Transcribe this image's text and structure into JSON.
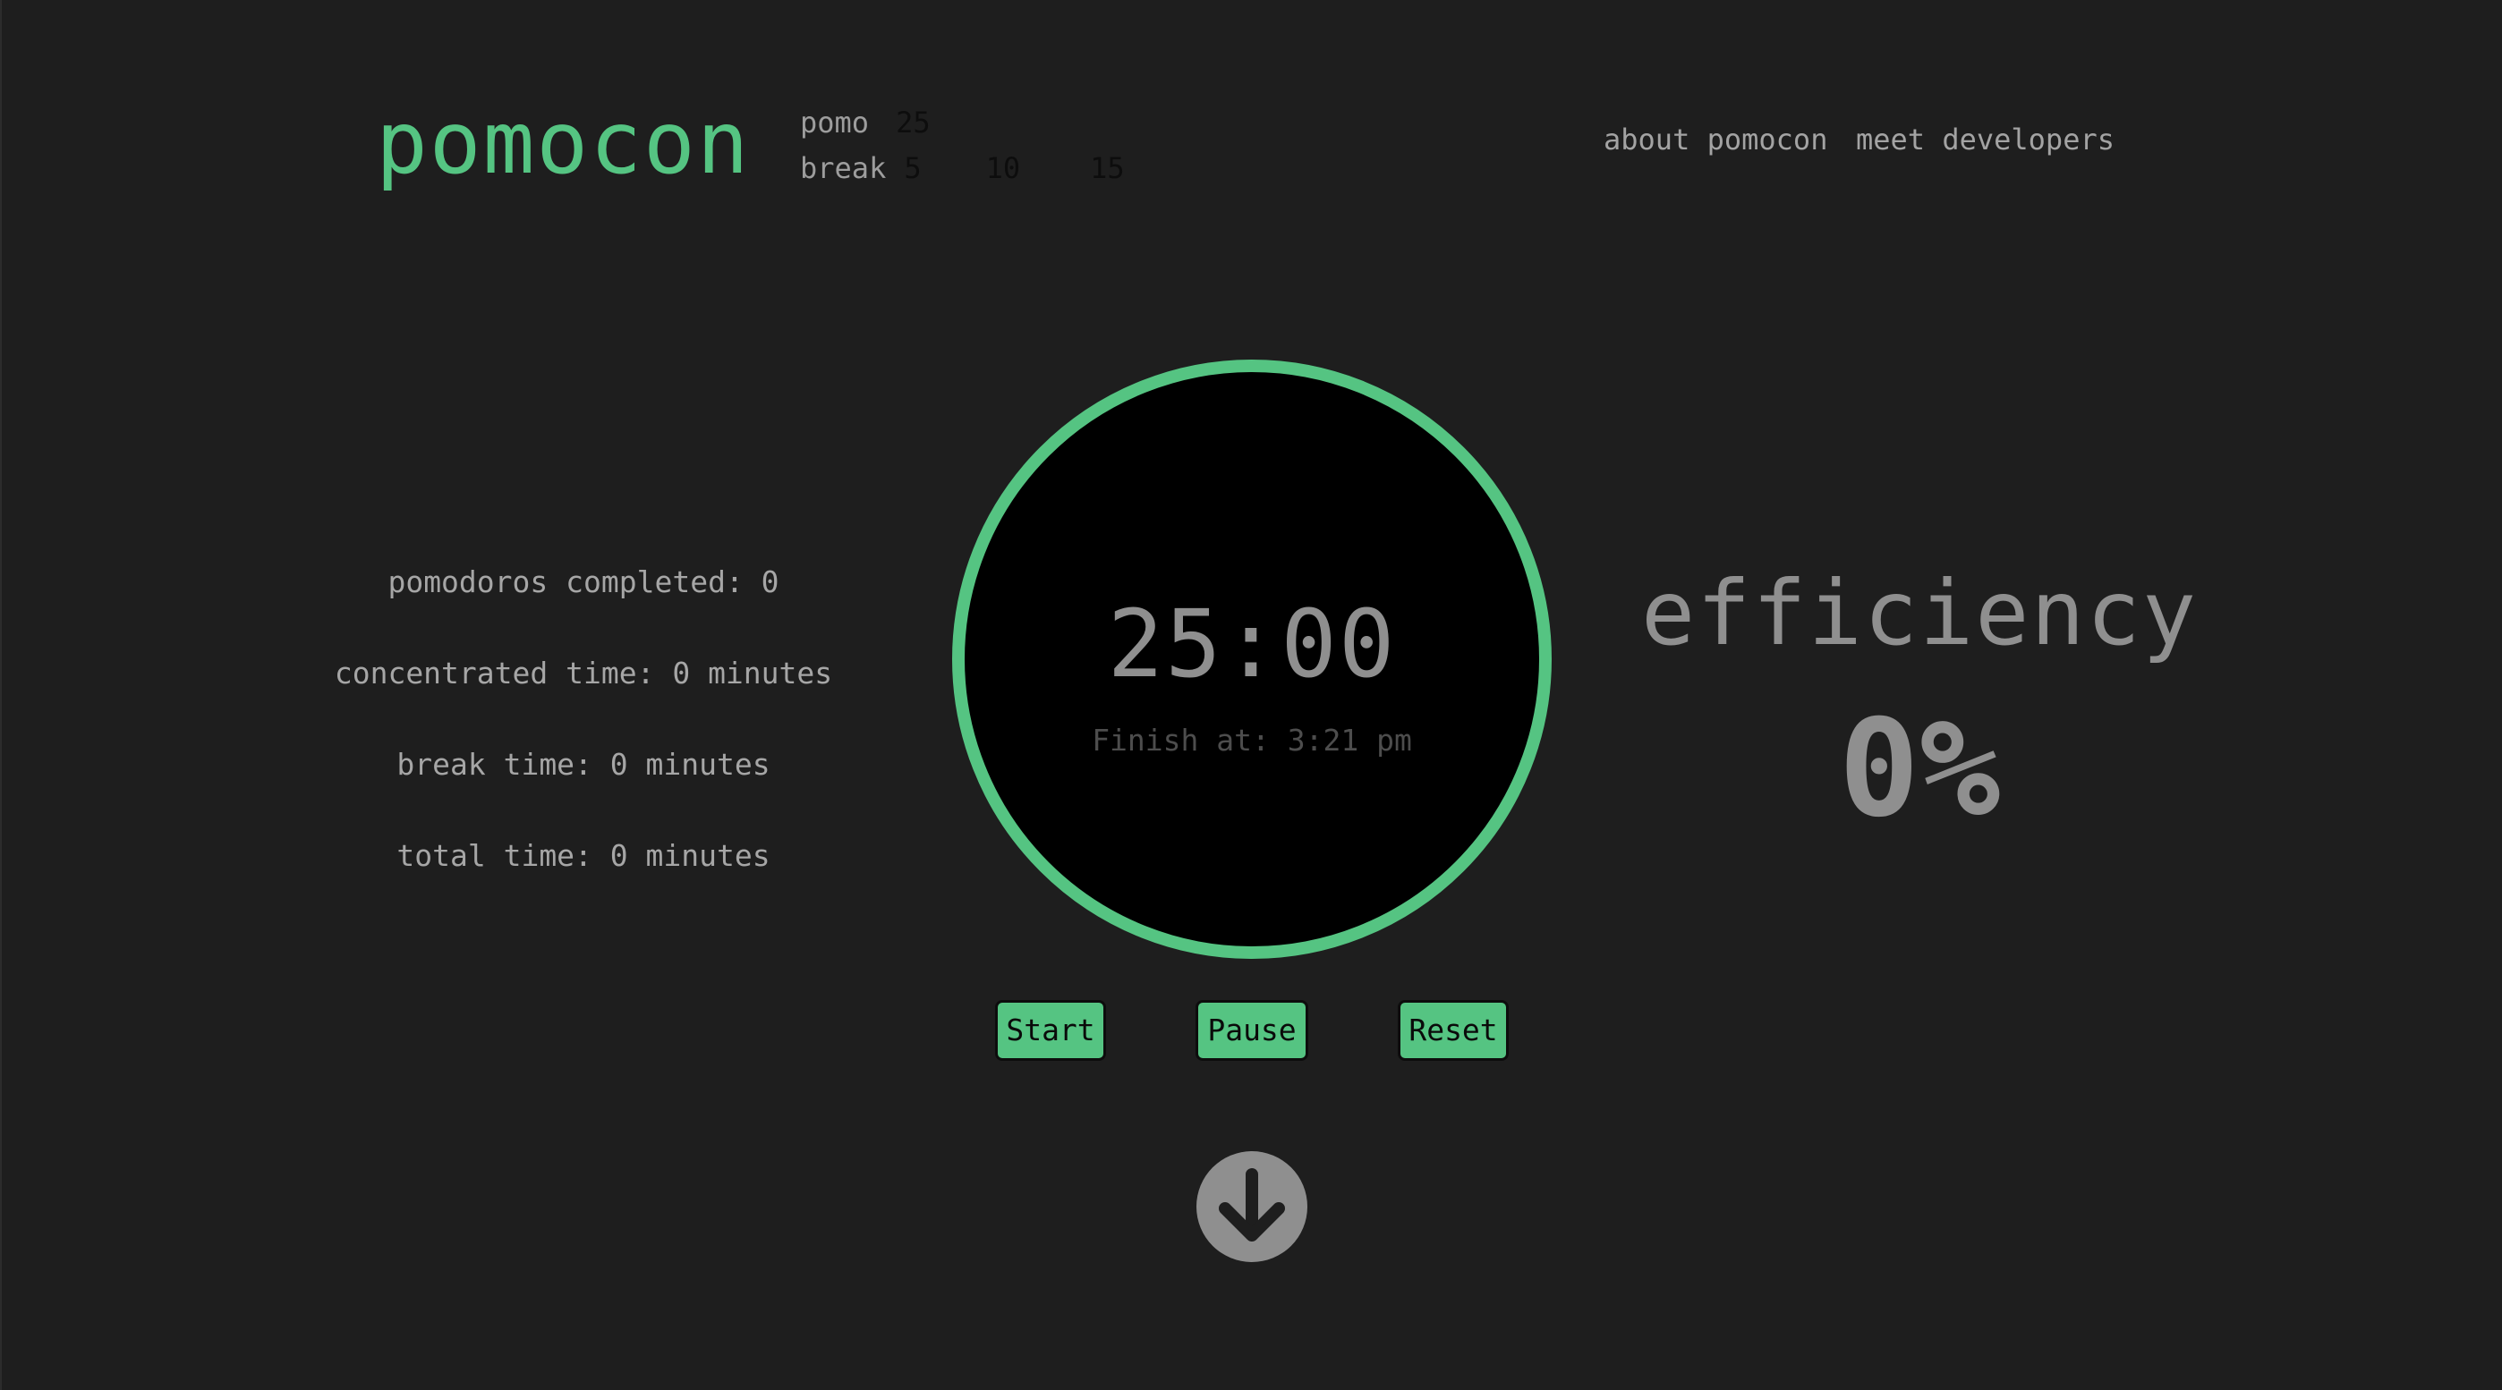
{
  "brand": {
    "logo": "pomocon",
    "accent_color": "#55c482"
  },
  "settings": {
    "pomo_label": "pomo",
    "pomo_options": [
      "25"
    ],
    "break_label": "break",
    "break_options": [
      "5",
      "10",
      "15"
    ]
  },
  "nav": {
    "about": "about pomocon",
    "developers": "meet developers"
  },
  "stats": {
    "pomodoros": "pomodoros completed: 0",
    "concentrated": "concentrated time: 0 minutes",
    "break_time": "break time: 0 minutes",
    "total": "total time: 0 minutes"
  },
  "timer": {
    "time": "25:00",
    "finish": "Finish at: 3:21 pm"
  },
  "controls": {
    "start": "Start",
    "pause": "Pause",
    "reset": "Reset"
  },
  "efficiency": {
    "title": "efficiency",
    "value": "0%"
  },
  "icons": {
    "scroll": "arrow-down-circle-icon"
  }
}
